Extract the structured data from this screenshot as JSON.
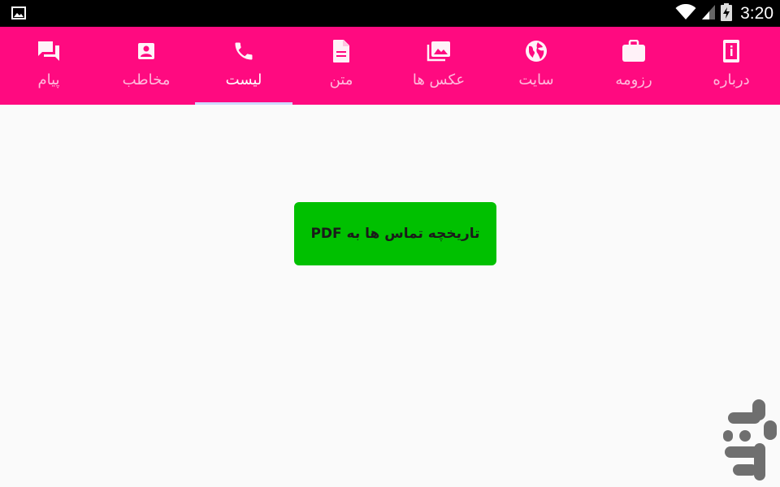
{
  "status_bar": {
    "time": "3:20",
    "icons": [
      "gallery-icon",
      "wifi-icon",
      "signal-icon",
      "battery-charging-icon"
    ]
  },
  "tabs": [
    {
      "label": "دربارە",
      "icon": "info-phone-icon",
      "active": false
    },
    {
      "label": "رزومه",
      "icon": "briefcase-icon",
      "active": false
    },
    {
      "label": "سایت",
      "icon": "globe-icon",
      "active": false
    },
    {
      "label": "عکس ها",
      "icon": "photo-library-icon",
      "active": false
    },
    {
      "label": "متن",
      "icon": "document-icon",
      "active": false
    },
    {
      "label": "لیست",
      "icon": "phone-icon",
      "active": true
    },
    {
      "label": "مخاطب",
      "icon": "contact-card-icon",
      "active": false
    },
    {
      "label": "پیام",
      "icon": "chat-icon",
      "active": false
    }
  ],
  "main": {
    "action_label": "تاریخچه تماس ها به PDF"
  },
  "colors": {
    "tab_bar": "#ff0a80",
    "button": "#00c000",
    "indicator": "#cfd8ff",
    "background": "#fafafa"
  },
  "watermark": {
    "icon": "app-store-logo-icon"
  }
}
